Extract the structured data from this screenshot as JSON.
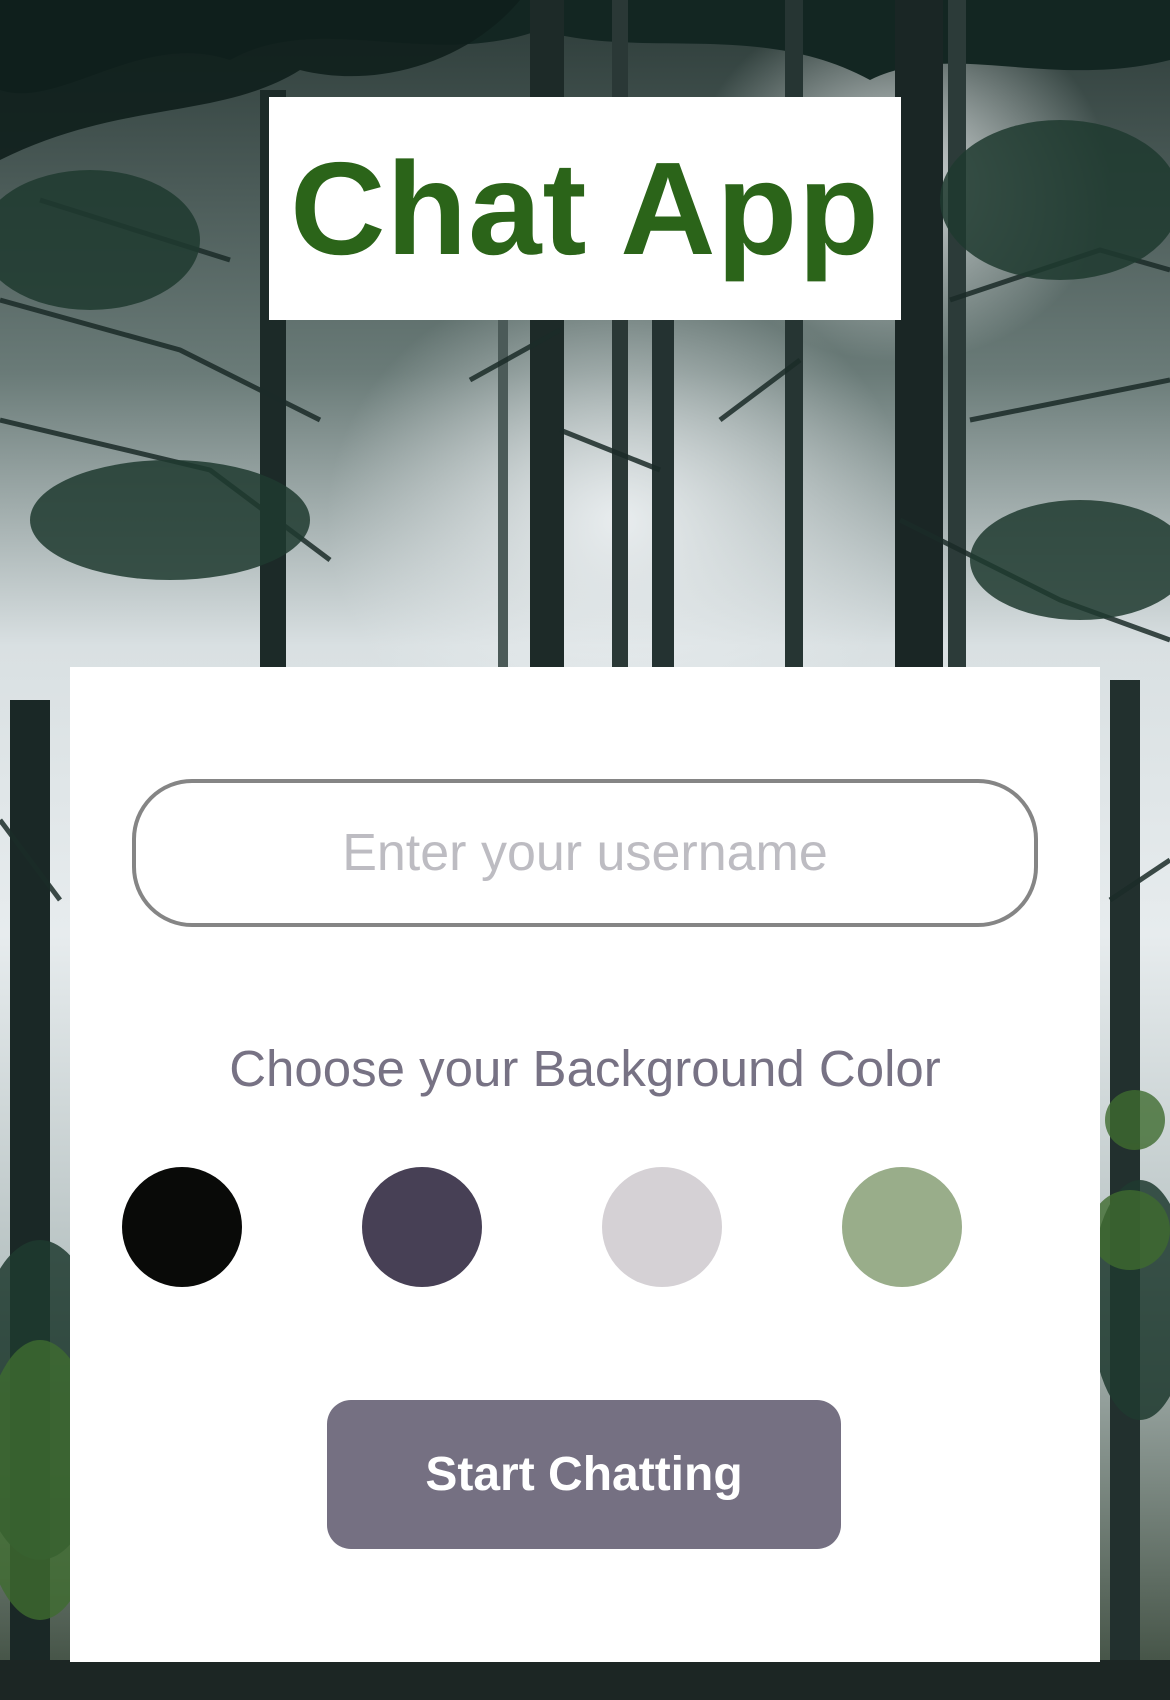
{
  "app": {
    "title": "Chat App",
    "title_color": "#2b6419"
  },
  "login": {
    "username_placeholder": "Enter your username",
    "username_value": "",
    "color_prompt": "Choose your Background Color",
    "colors": [
      {
        "name": "black",
        "hex": "#090a08"
      },
      {
        "name": "dark-purple",
        "hex": "#474055"
      },
      {
        "name": "light-gray",
        "hex": "#d5d1d5"
      },
      {
        "name": "sage-green",
        "hex": "#99ad8a"
      }
    ],
    "start_button_label": "Start Chatting",
    "start_button_color": "#757082"
  }
}
